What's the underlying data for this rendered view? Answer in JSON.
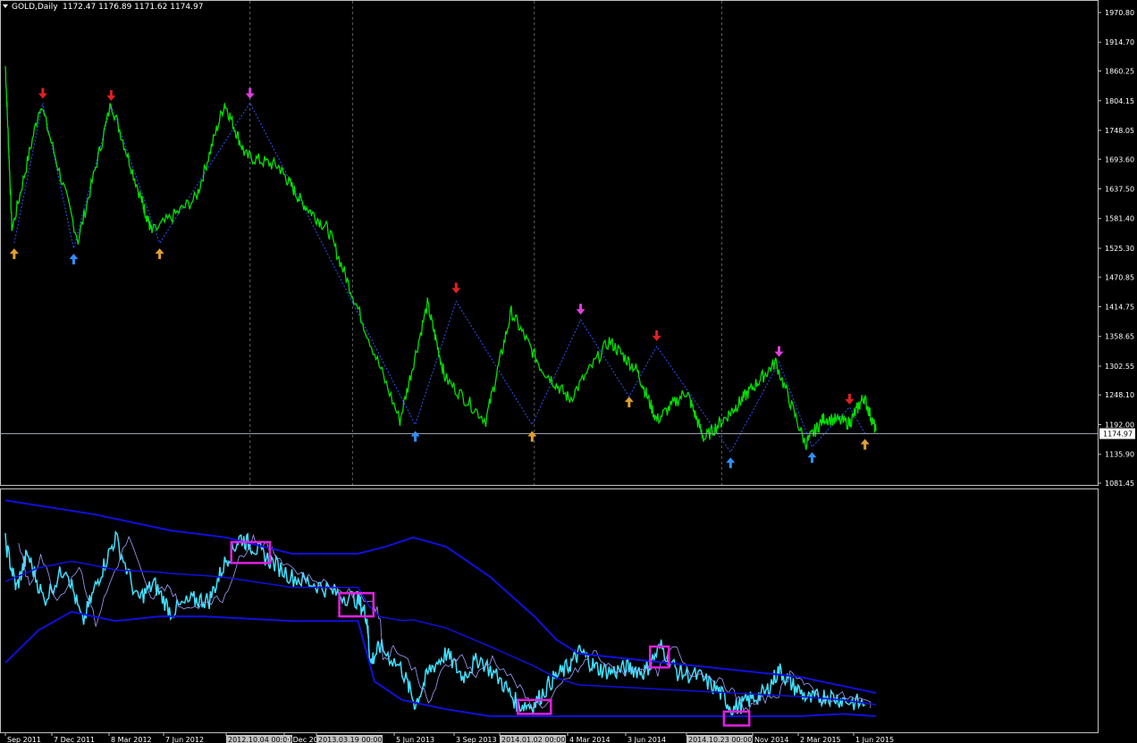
{
  "header": {
    "symbol": "GOLD,Daily",
    "ohlc": "1172.47 1176.89 1171.62 1174.97"
  },
  "colors": {
    "background": "#000000",
    "axis": "#c0c0c0",
    "price_line": "#00e000",
    "zigzag": "#3050ff",
    "current_price_line": "#a0a8b8",
    "arrow_red": "#e02020",
    "arrow_magenta": "#e040e0",
    "arrow_orange": "#e0a030",
    "arrow_blue": "#3090ff",
    "indicator_line": "#40e0ff",
    "band_outer": "#1010e0",
    "band_inner": "#a0a0ff",
    "highlight_box": "#e020e0",
    "vline": "#606060"
  },
  "chart_data": [
    {
      "type": "line",
      "name": "price",
      "ylim": [
        1081.45,
        1996
      ],
      "y_ticks": [
        "1970.80",
        "1914.70",
        "1860.25",
        "1804.15",
        "1748.05",
        "1693.60",
        "1637.50",
        "1581.40",
        "1525.30",
        "1470.85",
        "1414.75",
        "1358.65",
        "1302.55",
        "1248.10",
        "1192.00",
        "1135.90",
        "1081.45"
      ],
      "x_ticks": [
        "Sep 2011",
        "7 Dec 2011",
        "8 Mar 2012",
        "7 Jun 2012",
        "2012.10.04 00:00",
        "4 Dec 2012",
        "2013.03.19 00:00",
        "5 Jun 2013",
        "3 Sep 2013",
        "2014.01.02 00:00",
        "4 Mar 2014",
        "3 Jun 2014",
        "2014.10.23 00:00",
        "Nov 2014",
        "2 Mar 2015",
        "1 Jun 2015"
      ],
      "highlighted_x_ticks": [
        "2012.10.04 00:00",
        "2013.03.19 00:00",
        "2014.01.02 00:00",
        "2014.10.23 00:00"
      ],
      "current_price": "1174.97",
      "series": [
        {
          "x": [
            0,
            0.6,
            3.2,
            6.6,
            9.6,
            12.3,
            13.3,
            17.3,
            19.9,
            21.8,
            24.8,
            26.8,
            29.3,
            32,
            35.8,
            38.3,
            39.9,
            43.6,
            45.9,
            48.6,
            51.2,
            54.8,
            57.3,
            59.1,
            61.8,
            63.4,
            65.8,
            67.5,
            69.9,
            72.6,
            74.3,
            76.6,
            77.9,
            79
          ],
          "y": [
            1870,
            1560,
            1800,
            1540,
            1800,
            1620,
            1555,
            1620,
            1800,
            1700,
            1680,
            1615,
            1560,
            1410,
            1200,
            1420,
            1280,
            1200,
            1405,
            1300,
            1240,
            1350,
            1295,
            1200,
            1255,
            1165,
            1215,
            1255,
            1310,
            1155,
            1205,
            1195,
            1245,
            1180
          ]
        }
      ],
      "markers": [
        {
          "x": 0.8,
          "y": 1525,
          "dir": "up",
          "color": "orange"
        },
        {
          "x": 3.4,
          "y": 1808,
          "dir": "down",
          "color": "red"
        },
        {
          "x": 6.2,
          "y": 1515,
          "dir": "up",
          "color": "blue"
        },
        {
          "x": 9.6,
          "y": 1804,
          "dir": "down",
          "color": "red"
        },
        {
          "x": 14.0,
          "y": 1525,
          "dir": "up",
          "color": "orange"
        },
        {
          "x": 22.2,
          "y": 1808,
          "dir": "down",
          "color": "magenta"
        },
        {
          "x": 37.2,
          "y": 1180,
          "dir": "up",
          "color": "blue"
        },
        {
          "x": 40.9,
          "y": 1440,
          "dir": "down",
          "color": "red"
        },
        {
          "x": 47.8,
          "y": 1180,
          "dir": "up",
          "color": "orange"
        },
        {
          "x": 52.2,
          "y": 1400,
          "dir": "down",
          "color": "magenta"
        },
        {
          "x": 56.6,
          "y": 1245,
          "dir": "up",
          "color": "orange"
        },
        {
          "x": 59.1,
          "y": 1350,
          "dir": "down",
          "color": "red"
        },
        {
          "x": 65.8,
          "y": 1130,
          "dir": "up",
          "color": "blue"
        },
        {
          "x": 70.2,
          "y": 1320,
          "dir": "down",
          "color": "magenta"
        },
        {
          "x": 73.2,
          "y": 1140,
          "dir": "up",
          "color": "blue"
        },
        {
          "x": 76.6,
          "y": 1230,
          "dir": "down",
          "color": "red"
        },
        {
          "x": 78.0,
          "y": 1165,
          "dir": "up",
          "color": "orange"
        }
      ],
      "zigzag": [
        {
          "x": 0.8,
          "y": 1535
        },
        {
          "x": 3.4,
          "y": 1800
        },
        {
          "x": 6.2,
          "y": 1525
        },
        {
          "x": 9.6,
          "y": 1795
        },
        {
          "x": 14.0,
          "y": 1535
        },
        {
          "x": 22.2,
          "y": 1800
        },
        {
          "x": 37.2,
          "y": 1192
        },
        {
          "x": 40.9,
          "y": 1425
        },
        {
          "x": 47.8,
          "y": 1192
        },
        {
          "x": 52.2,
          "y": 1390
        },
        {
          "x": 56.6,
          "y": 1245
        },
        {
          "x": 59.1,
          "y": 1340
        },
        {
          "x": 65.8,
          "y": 1140
        },
        {
          "x": 70.2,
          "y": 1310
        },
        {
          "x": 73.2,
          "y": 1150
        },
        {
          "x": 76.6,
          "y": 1225
        },
        {
          "x": 78.0,
          "y": 1175
        }
      ],
      "vertical_lines_x": [
        22.2,
        31.5,
        48.0,
        65.0
      ]
    },
    {
      "type": "line",
      "name": "indicator",
      "ylim": [
        0,
        100
      ],
      "series": [
        {
          "x": [
            0,
            1,
            2,
            3.5,
            5.5,
            7,
            8.5,
            10,
            12,
            13.5,
            15,
            17,
            18.5,
            20,
            21.3,
            22.5,
            24,
            26,
            28,
            30,
            32,
            32.8,
            33.1,
            34,
            36,
            37.2,
            38.5,
            40,
            41.5,
            43,
            45,
            46.5,
            48,
            49.5,
            51,
            52.2,
            53.5,
            55,
            56.6,
            58,
            59.5,
            61,
            63,
            64.7,
            66,
            67.5,
            69,
            70.2,
            71.5,
            73,
            74.5,
            76,
            78
          ],
          "y": [
            80,
            60,
            75,
            55,
            70,
            45,
            65,
            82,
            55,
            62,
            50,
            55,
            55,
            72,
            82,
            78,
            72,
            65,
            62,
            58,
            55,
            48,
            28,
            35,
            25,
            10,
            25,
            32,
            22,
            30,
            20,
            10,
            10,
            20,
            26,
            33,
            26,
            24,
            26,
            24,
            35,
            24,
            22,
            16,
            8,
            12,
            15,
            25,
            18,
            12,
            14,
            12,
            10
          ]
        },
        {
          "name": "upper band",
          "x": [
            0,
            8,
            15,
            20,
            26,
            32,
            34.5,
            37,
            40,
            44,
            48,
            50,
            52,
            56,
            60,
            64,
            68,
            72,
            76,
            79
          ],
          "y": [
            98,
            92,
            85,
            82,
            75,
            75,
            78,
            82,
            78,
            65,
            48,
            38,
            32,
            30,
            28,
            26,
            24,
            22,
            18,
            15
          ]
        },
        {
          "name": "lower band",
          "x": [
            0,
            3,
            6,
            10,
            14,
            18,
            22,
            26,
            32,
            33.5,
            36,
            40,
            44,
            48,
            52,
            56,
            60,
            64,
            68,
            72,
            76,
            79
          ],
          "y": [
            28,
            42,
            50,
            46,
            48,
            48,
            47,
            46,
            46,
            20,
            12,
            8,
            5,
            5,
            5,
            5,
            5,
            5,
            5,
            5,
            6,
            5
          ]
        }
      ],
      "highlight_boxes": [
        {
          "x0": 20.5,
          "x1": 24.0,
          "y0": 71,
          "y1": 80
        },
        {
          "x0": 30.3,
          "x1": 33.4,
          "y0": 48,
          "y1": 58
        },
        {
          "x0": 46.5,
          "x1": 49.5,
          "y0": 6,
          "y1": 12
        },
        {
          "x0": 58.5,
          "x1": 60.2,
          "y0": 26,
          "y1": 35
        },
        {
          "x0": 65.2,
          "x1": 67.5,
          "y0": 1,
          "y1": 7
        }
      ]
    }
  ]
}
